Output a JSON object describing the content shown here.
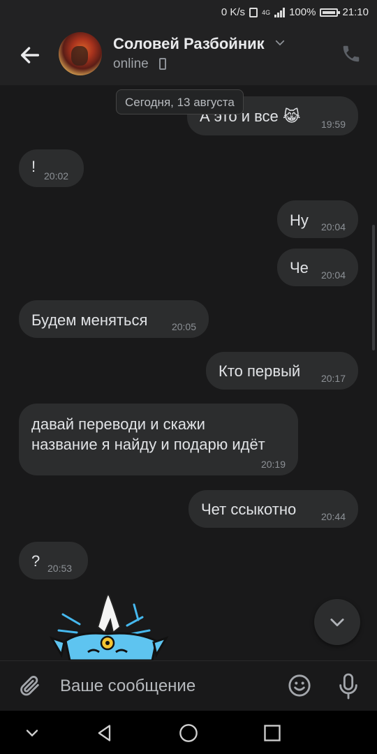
{
  "status_bar": {
    "net_speed": "0 K/s",
    "network": "4G",
    "battery": "100%",
    "time": "21:10"
  },
  "header": {
    "contact_name": "Соловей Разбойник",
    "status": "online"
  },
  "chat": {
    "date_badge": "Сегодня, 13 августа",
    "messages": [
      {
        "text": "А это и все 😹",
        "time": "19:59",
        "side": "out"
      },
      {
        "text": "!",
        "time": "20:02",
        "side": "in"
      },
      {
        "text": "Ну",
        "time": "20:04",
        "side": "out"
      },
      {
        "text": "Че",
        "time": "20:04",
        "side": "out"
      },
      {
        "text": "Будем меняться",
        "time": "20:05",
        "side": "in"
      },
      {
        "text": "Кто первый",
        "time": "20:17",
        "side": "out"
      },
      {
        "text_line1": "давай переводи и скажи",
        "text_line2": "название я найду и подарю идёт",
        "time": "20:19",
        "side": "in"
      },
      {
        "text": "Чет ссыкотно",
        "time": "20:44",
        "side": "out"
      },
      {
        "text": "?",
        "time": "20:53",
        "side": "in"
      }
    ]
  },
  "composer": {
    "placeholder": "Ваше сообщение"
  },
  "icons": {
    "back": "arrow-left-icon",
    "call": "phone-icon",
    "attach": "paperclip-icon",
    "emoji": "smiley-icon",
    "mic": "microphone-icon",
    "scroll_down": "chevron-down-icon"
  },
  "colors": {
    "background": "#19191a",
    "bubble": "#2c2d2e",
    "header": "#222223"
  }
}
